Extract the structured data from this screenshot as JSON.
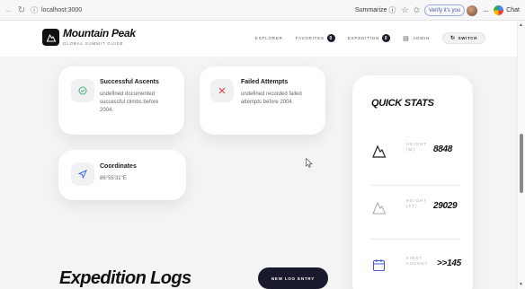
{
  "browser": {
    "url": "localhost:3000",
    "summarize_label": "Summarize",
    "verify_label": "Verify it's you",
    "chat_label": "Chat"
  },
  "header": {
    "brand_name": "Mountain Peak",
    "brand_subtitle": "GLOBAL SUMMIT GUIDE",
    "nav": {
      "explorer": "EXPLORER",
      "favorites": "FAVORITES",
      "favorites_count": "0",
      "expedition": "EXPEDITION",
      "expedition_count": "0",
      "admin": "ADMIN",
      "switch": "SWITCH"
    }
  },
  "cards": {
    "successful": {
      "title": "Successful Ascents",
      "description": "undefined documented successful climbs before 2004.",
      "icon": "check-circle-icon",
      "icon_color": "#4caf7d"
    },
    "failed": {
      "title": "Failed Attempts",
      "description": "undefined recorded failed attempts before 2004.",
      "icon": "x-icon",
      "icon_color": "#e0424f"
    },
    "coordinates": {
      "title": "Coordinates",
      "value": "86°55'31\"E",
      "icon": "navigation-arrow-icon",
      "icon_color": "#3f6fd8"
    }
  },
  "quick_stats": {
    "title": "QUICK STATS",
    "rows": [
      {
        "label_line1": "HEIGHT",
        "label_line2": "(M)",
        "value": "8848",
        "icon": "mountain-icon"
      },
      {
        "label_line1": "HEIGHT",
        "label_line2": "(FT)",
        "value": "29029",
        "icon": "mountain-outline-icon"
      },
      {
        "label_line1": "FIRST",
        "label_line2": "ASCENT",
        "value": ">>145",
        "icon": "calendar-icon"
      }
    ]
  },
  "expedition": {
    "heading": "Expedition Logs",
    "new_entry_label": "NEW LOG ENTRY"
  },
  "colors": {
    "accent_dark": "#1a1a2e",
    "page_bg": "#f4f4f5"
  }
}
